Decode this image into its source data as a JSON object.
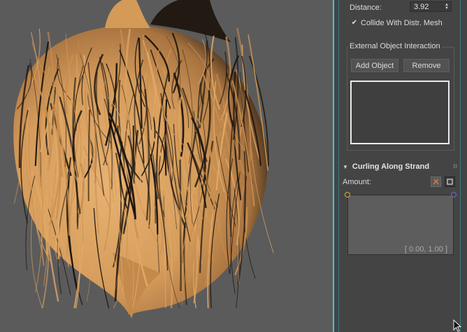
{
  "viewport": {
    "content": "hair-render",
    "colors": {
      "background": "#5b5b5b",
      "hair_light": "#e1a766",
      "hair_mid": "#c98f50",
      "hair_dark": "#1b150f"
    }
  },
  "panel": {
    "distance": {
      "label": "Distance:",
      "value": "3.92"
    },
    "collide": {
      "label": "Collide With Distr. Mesh",
      "checked": true,
      "check_glyph": "✔"
    },
    "external_group": {
      "title": "External Object Interaction",
      "add_button": "Add Object",
      "remove_button": "Remove"
    },
    "curling": {
      "header": "Curling Along Strand",
      "amount_label": "Amount:",
      "range_label": "[ 0.00, 1.00 ]"
    }
  },
  "colors": {
    "accent": "#48c3d3",
    "panel_bg": "#444444",
    "curve_bg": "#5d5d5d"
  },
  "icons": [
    "spinner-arrows-icon",
    "checkmark-icon",
    "collapse-arrow-icon",
    "drag-handle-icon",
    "reset-curve-icon",
    "maximize-icon",
    "mouse-cursor-icon"
  ]
}
